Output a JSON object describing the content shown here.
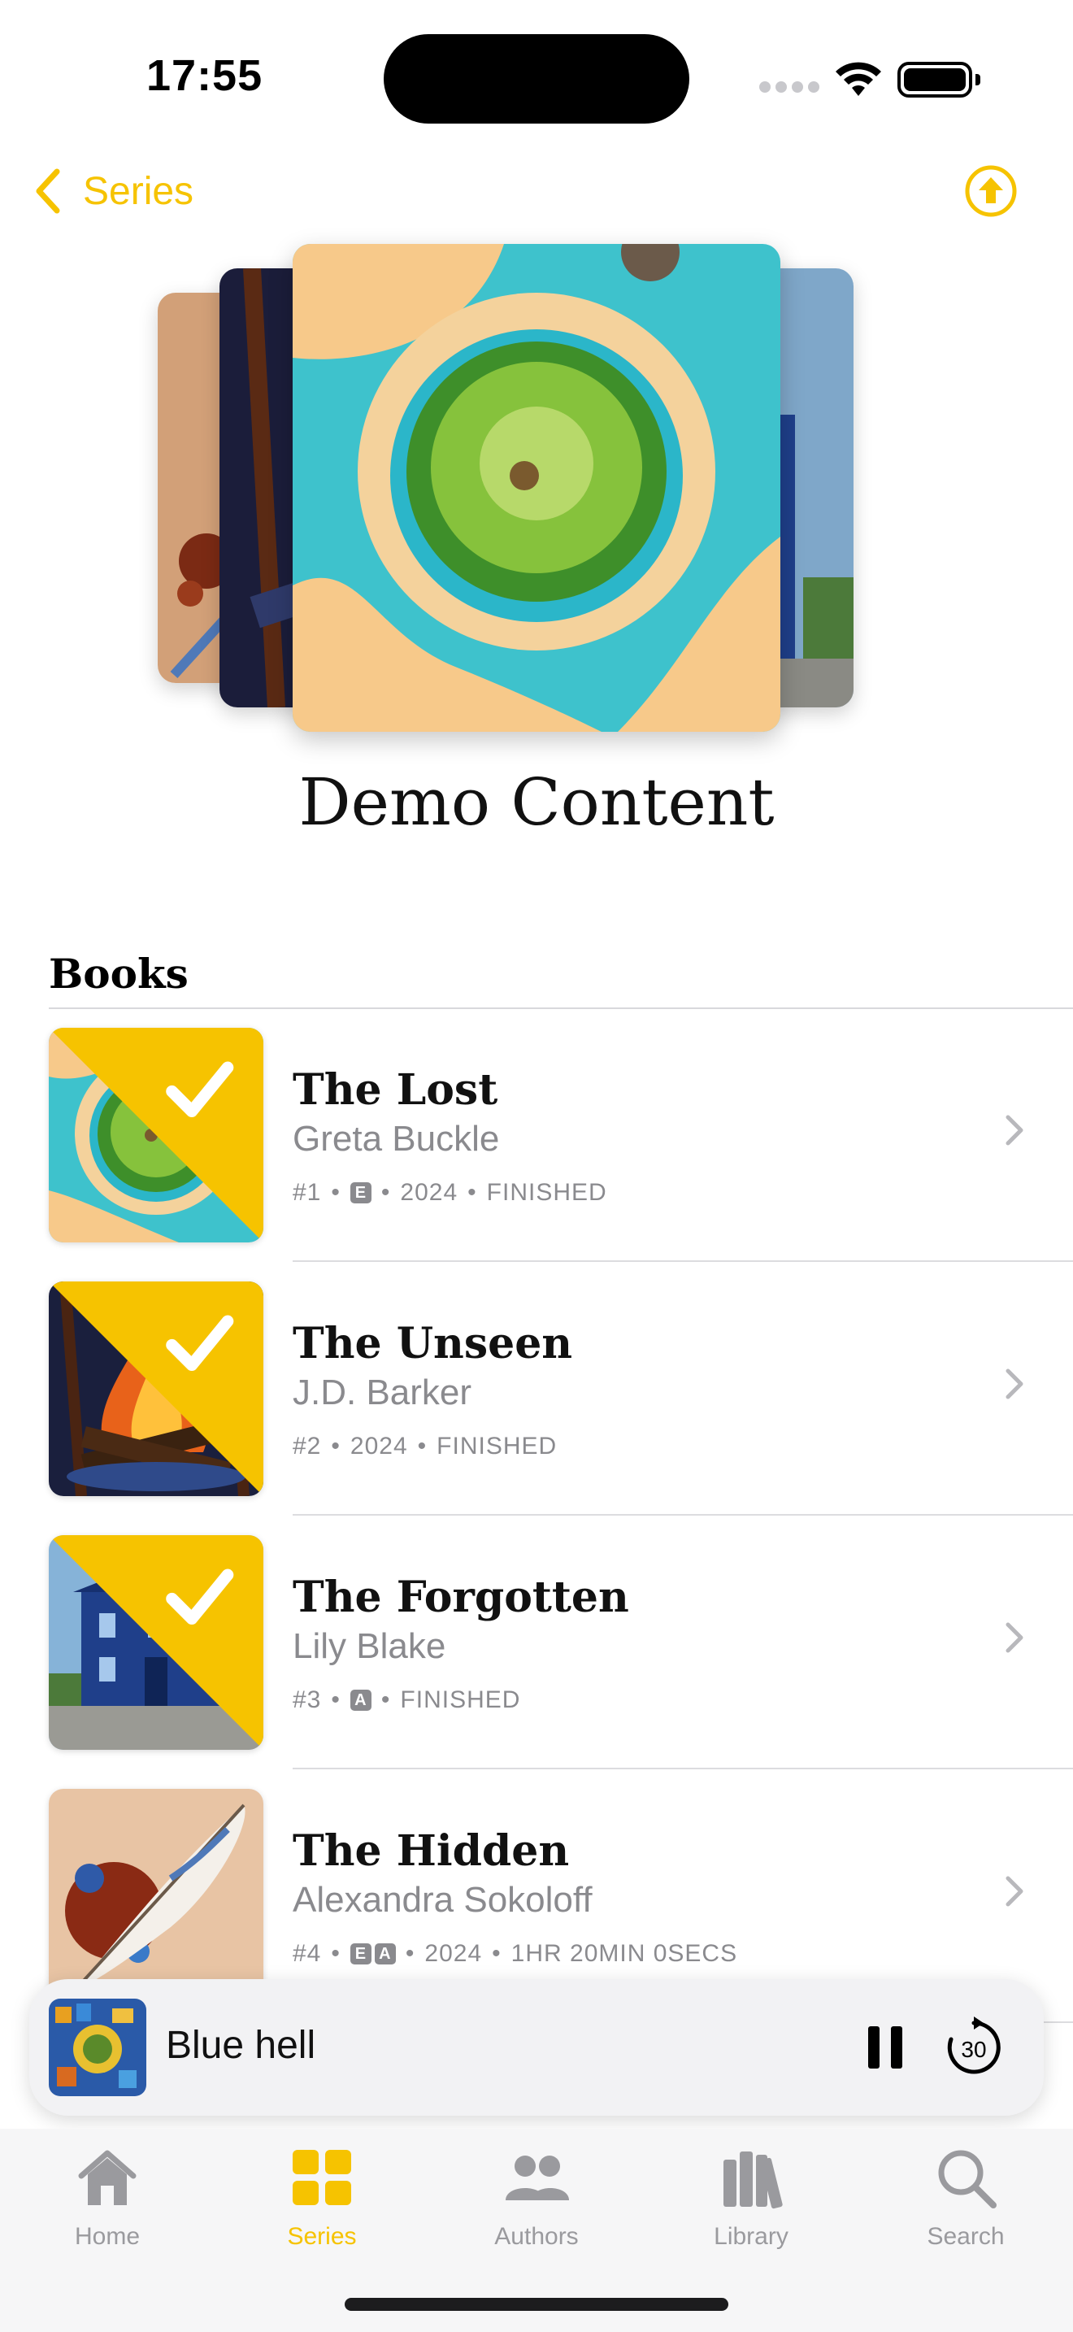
{
  "status_bar": {
    "time": "17:55"
  },
  "nav": {
    "back_label": "Series"
  },
  "series": {
    "title": "Demo Content"
  },
  "books_section": {
    "header": "Books",
    "items": [
      {
        "title": "The Lost",
        "author": "Greta Buckle",
        "number": "#1",
        "badges": [
          "E"
        ],
        "year": "2024",
        "status": "FINISHED",
        "finished": true
      },
      {
        "title": "The Unseen",
        "author": "J.D. Barker",
        "number": "#2",
        "badges": [],
        "year": "2024",
        "status": "FINISHED",
        "finished": true
      },
      {
        "title": "The Forgotten",
        "author": "Lily Blake",
        "number": "#3",
        "badges": [
          "A"
        ],
        "year": "",
        "status": "FINISHED",
        "finished": true
      },
      {
        "title": "The Hidden",
        "author": "Alexandra Sokoloff",
        "number": "#4",
        "badges": [
          "E",
          "A"
        ],
        "year": "2024",
        "status": "1HR 20MIN 0SECS",
        "finished": false
      }
    ]
  },
  "mini_player": {
    "title": "Blue hell",
    "skip_label": "30"
  },
  "tabs": [
    {
      "label": "Home",
      "icon": "house-icon",
      "active": false
    },
    {
      "label": "Series",
      "icon": "grid-icon",
      "active": true
    },
    {
      "label": "Authors",
      "icon": "people-icon",
      "active": false
    },
    {
      "label": "Library",
      "icon": "books-icon",
      "active": false
    },
    {
      "label": "Search",
      "icon": "magnifier-icon",
      "active": false
    }
  ],
  "colors": {
    "accent": "#f6c300",
    "secondary_text": "#8a8a8e"
  }
}
